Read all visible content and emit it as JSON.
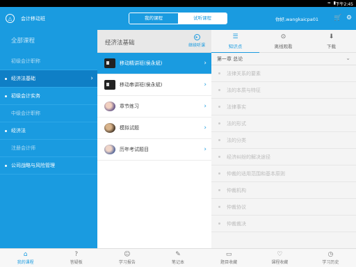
{
  "status_bar": {
    "time": "下午2:45",
    "icons": "≈ ▮"
  },
  "header": {
    "title": "会计移动班",
    "segment": [
      "我的课程",
      "试听课程"
    ],
    "greeting": "你好,wangkaicpa01",
    "cart_icon": "🛒",
    "settings_icon": "⚙"
  },
  "sidebar": {
    "all_label": "全部课程",
    "items": [
      {
        "label": "初级会计职称"
      },
      {
        "label": "经济法基础"
      },
      {
        "label": "初级会计实务"
      },
      {
        "label": "中级会计职称"
      },
      {
        "label": "经济法"
      },
      {
        "label": "注册会计师"
      },
      {
        "label": "公司战略与风险管理"
      }
    ]
  },
  "middle": {
    "title": "经济法基础",
    "continue_label": "继续听课",
    "items": [
      {
        "label": "移动精讲班(侯永斌)"
      },
      {
        "label": "移动串讲班(侯永斌)"
      },
      {
        "label": "章节练习"
      },
      {
        "label": "模拟试题"
      },
      {
        "label": "历年考试题目"
      }
    ]
  },
  "right": {
    "tabs": [
      {
        "label": "知识点",
        "icon": "☰"
      },
      {
        "label": "离线观看",
        "icon": "⊙"
      },
      {
        "label": "下载",
        "icon": "⬇"
      }
    ],
    "chapter": "第一章  总论",
    "points": [
      "法律关系的要素",
      "法的本质与特征",
      "法律事实",
      "法的形式",
      "法的分类",
      "经济纠纷的解决途径",
      "仲裁的适用范围和基本原则",
      "仲裁机构",
      "仲裁协议",
      "仲裁裁决"
    ]
  },
  "bottom_nav": [
    {
      "label": "我的课程",
      "icon": "⌂"
    },
    {
      "label": "答疑板",
      "icon": "?"
    },
    {
      "label": "学习报告",
      "icon": "☺"
    },
    {
      "label": "笔记本",
      "icon": "✎"
    },
    {
      "label": "题目收藏",
      "icon": "▭"
    },
    {
      "label": "课程收藏",
      "icon": "♡"
    },
    {
      "label": "学习历史",
      "icon": "◷"
    }
  ]
}
